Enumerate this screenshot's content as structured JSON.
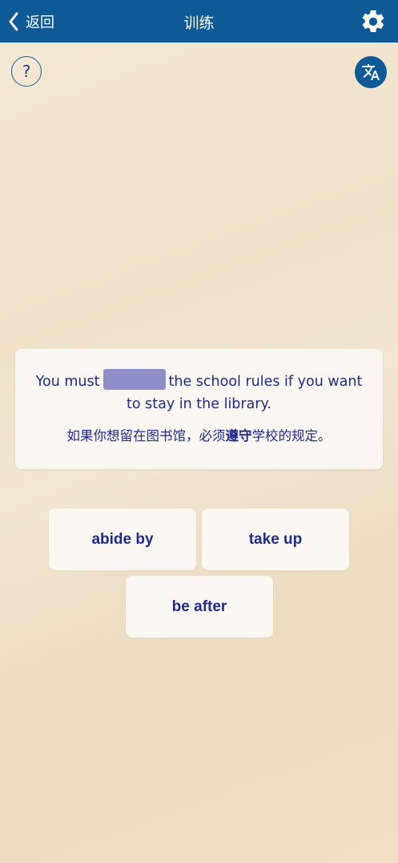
{
  "header": {
    "back_label": "返回",
    "title": "训练",
    "settings_icon": "gear-icon"
  },
  "toolbar": {
    "help_label": "?",
    "translate_icon": "translate-icon"
  },
  "exercise": {
    "sentence_before": "You must",
    "sentence_after": "the school rules if you want to stay in the library.",
    "translation_before": "如果你想留在图书馆，必须",
    "translation_highlight": "遵守",
    "translation_after": "学校的规定。"
  },
  "options": [
    "abide by",
    "take up",
    "be after"
  ],
  "colors": {
    "header_bg": "#0e5a96",
    "text_primary": "#1f2a8a",
    "blank_fill": "#8e8ec8"
  }
}
